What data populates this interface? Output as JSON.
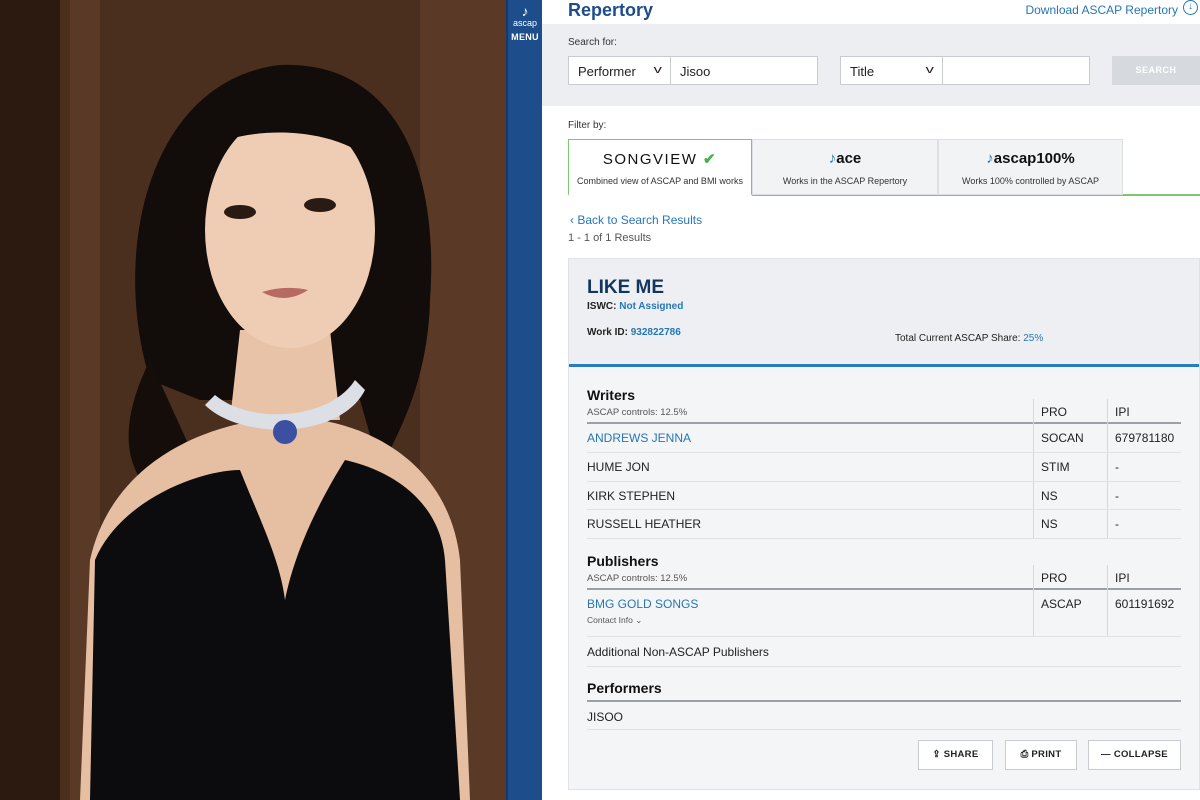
{
  "sidebar": {
    "logo_text": "ascap",
    "menu_label": "MENU"
  },
  "header": {
    "title": "Repertory",
    "download_label": "Download ASCAP Repertory"
  },
  "search": {
    "label": "Search for:",
    "field1_type": "Performer",
    "field1_value": "Jisoo",
    "field2_type": "Title",
    "field2_value": "",
    "button_label": "SEARCH"
  },
  "filter": {
    "label": "Filter by:",
    "tabs": [
      {
        "name": "SONGVIEW",
        "desc": "Combined view of ASCAP and BMI works",
        "active": true
      },
      {
        "name": "ace",
        "desc": "Works in the ASCAP Repertory",
        "active": false
      },
      {
        "name": "ascap100%",
        "desc": "Works 100% controlled by ASCAP",
        "active": false
      }
    ]
  },
  "results": {
    "back_label": "Back to Search Results",
    "count": "1 - 1 of 1 Results"
  },
  "work": {
    "title": "LIKE ME",
    "iswc_label": "ISWC:",
    "iswc_value": "Not Assigned",
    "workid_label": "Work ID:",
    "workid_value": "932822786",
    "share_label": "Total Current ASCAP Share:",
    "share_value": "25%"
  },
  "writers": {
    "title": "Writers",
    "controls": "ASCAP controls: 12.5%",
    "col_pro": "PRO",
    "col_ipi": "IPI",
    "rows": [
      {
        "name": "ANDREWS JENNA",
        "pro": "SOCAN",
        "ipi": "679781180"
      },
      {
        "name": "HUME JON",
        "pro": "STIM",
        "ipi": "-"
      },
      {
        "name": "KIRK STEPHEN",
        "pro": "NS",
        "ipi": "-"
      },
      {
        "name": "RUSSELL HEATHER",
        "pro": "NS",
        "ipi": "-"
      }
    ]
  },
  "publishers": {
    "title": "Publishers",
    "controls": "ASCAP controls: 12.5%",
    "col_pro": "PRO",
    "col_ipi": "IPI",
    "rows": [
      {
        "name": "BMG GOLD SONGS",
        "contact": "Contact Info",
        "pro": "ASCAP",
        "ipi": "601191692"
      }
    ],
    "additional": "Additional Non-ASCAP Publishers"
  },
  "performers": {
    "title": "Performers",
    "rows": [
      "JISOO"
    ]
  },
  "actions": {
    "share": "SHARE",
    "print": "PRINT",
    "collapse": "COLLAPSE"
  },
  "colors": {
    "brand_blue": "#1d4d8a",
    "link_blue": "#2577b5",
    "accent_green": "#7dc76f"
  }
}
